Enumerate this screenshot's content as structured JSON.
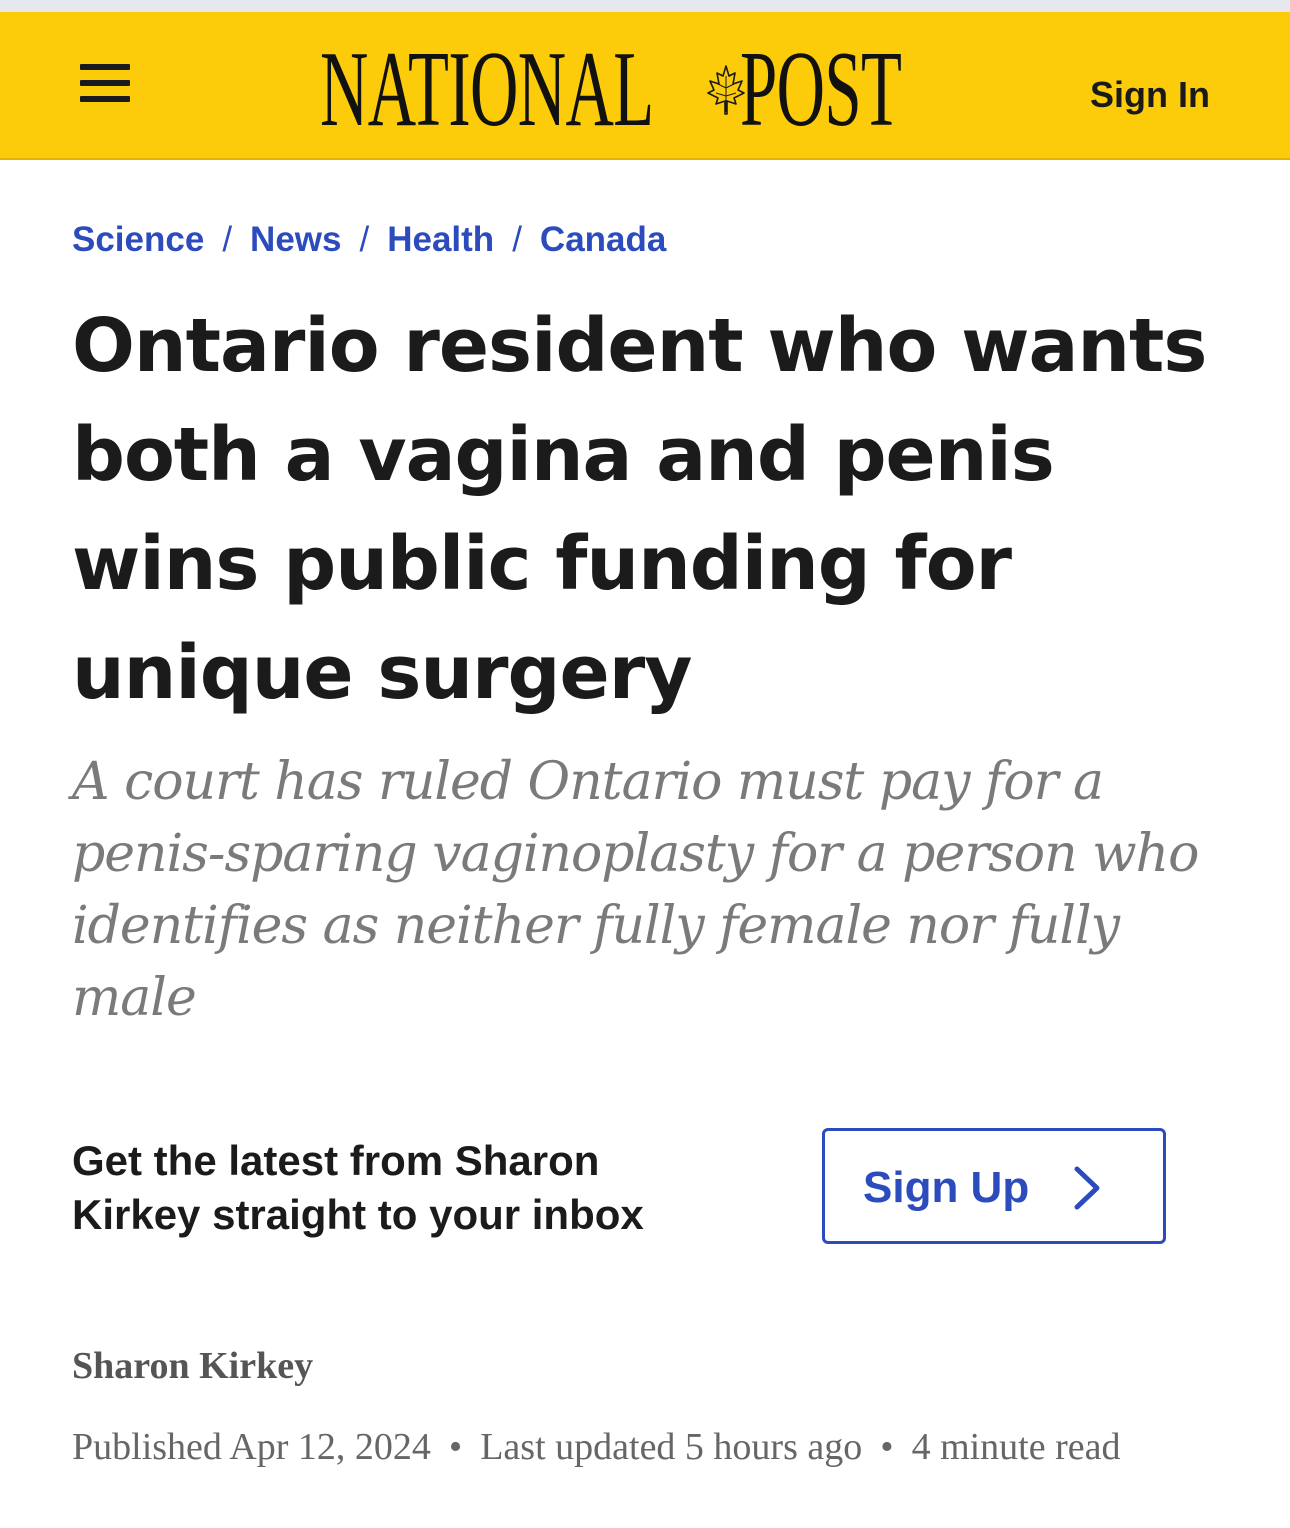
{
  "header": {
    "logo_left": "NATIONAL",
    "logo_right": "POST",
    "sign_in_label": "Sign In",
    "background_color": "#fccc0a",
    "menu_icon": "hamburger-menu-icon",
    "logo_icon": "maple-leaf-icon"
  },
  "breadcrumb": {
    "items": [
      "Science",
      "News",
      "Health",
      "Canada"
    ],
    "separator": "/",
    "link_color": "#2c4bbd"
  },
  "article": {
    "headline": "Ontario resident who wants both a vagina and penis wins public funding for unique surgery",
    "dek": "A court has ruled Ontario must pay for a penis-sparing vaginoplasty for a person who identifies as neither fully female nor fully male",
    "author": "Sharon Kirkey",
    "published": "Published Apr 12, 2024",
    "updated": "Last updated 5 hours ago",
    "read_time": "4 minute read",
    "meta_separator": "•"
  },
  "newsletter": {
    "prompt": "Get the latest from Sharon Kirkey straight to your inbox",
    "button_label": "Sign Up",
    "button_icon": "chevron-right-icon"
  }
}
